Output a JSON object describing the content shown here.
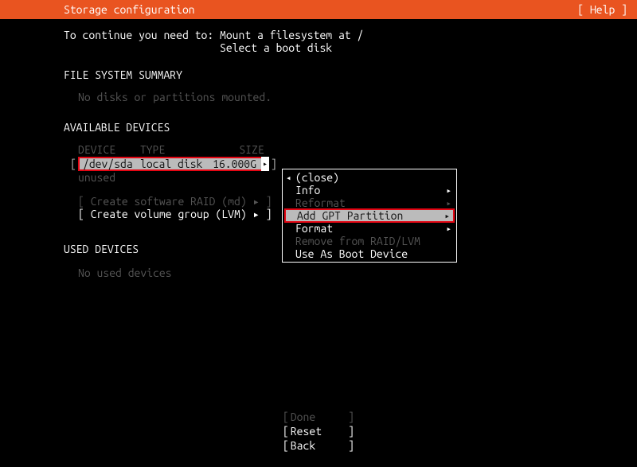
{
  "header": {
    "title": "Storage configuration",
    "help_label": "[ Help ]"
  },
  "instructions": {
    "line1": "To continue you need to: Mount a filesystem at /",
    "line2": "Select a boot disk"
  },
  "sections": {
    "fs_summary_title": "FILE SYSTEM SUMMARY",
    "fs_summary_body": "No disks or partitions mounted.",
    "available_title": "AVAILABLE DEVICES",
    "used_title": "USED DEVICES",
    "used_body": "No used devices"
  },
  "columns": {
    "device": "DEVICE",
    "type": "TYPE",
    "size": "SIZE"
  },
  "device_row": {
    "bracket_open": "[",
    "name": "/dev/sda",
    "type": "local disk",
    "size": "16.000G",
    "arrow": "▸",
    "bracket_close": "]"
  },
  "unused_label": "unused",
  "raid_label": "[ Create software RAID (md) ▸ ]",
  "lvm_label": "[ Create volume group (LVM) ▸ ]",
  "context_menu": {
    "close": "(close)",
    "info": "Info",
    "reformat": "Reformat",
    "add_gpt": "Add GPT Partition",
    "format": "Format",
    "remove": "Remove from RAID/LVM",
    "boot": "Use As Boot Device"
  },
  "footer": {
    "done": "Done",
    "reset": "Reset",
    "back": "Back"
  }
}
